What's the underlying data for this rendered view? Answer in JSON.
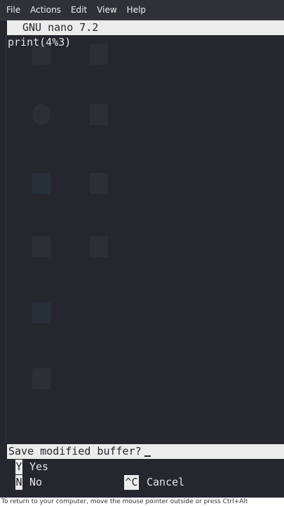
{
  "menubar": {
    "items": [
      "File",
      "Actions",
      "Edit",
      "View",
      "Help"
    ]
  },
  "nano": {
    "title": "GNU nano 7.2"
  },
  "buffer": {
    "lines": [
      "print(4%3)"
    ]
  },
  "prompt": {
    "question": "Save modified buffer?",
    "options": [
      {
        "key": "Y",
        "label": "Yes"
      },
      {
        "key": "N",
        "label": "No"
      },
      {
        "key": "^C",
        "label": "Cancel"
      }
    ]
  },
  "footer": {
    "hint": "To return to your computer, move the mouse pointer outside or press Ctrl+Alt"
  }
}
